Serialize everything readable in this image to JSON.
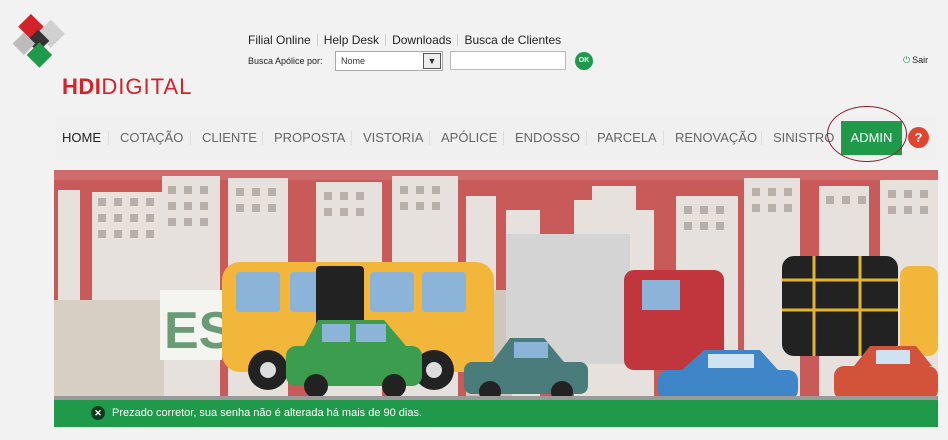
{
  "brand": {
    "logo_prefix": "HDI",
    "logo_suffix": "DIGITAL"
  },
  "top_links": [
    "Filial Online",
    "Help Desk",
    "Downloads",
    "Busca de Clientes"
  ],
  "search": {
    "label": "Busca Apólice por:",
    "selected": "Nome",
    "input_value": "",
    "ok_label": "OK"
  },
  "logout": {
    "label": "Sair"
  },
  "nav": {
    "items": [
      "HOME",
      "COTAÇÃO",
      "CLIENTE",
      "PROPOSTA",
      "VISTORIA",
      "APÓLICE",
      "ENDOSSO",
      "PARCELA",
      "RENOVAÇÃO",
      "SINISTRO"
    ],
    "admin_label": "ADMIN",
    "help_label": "?"
  },
  "banner": {
    "partial_text": "ES"
  },
  "notice": {
    "message": "Prezado corretor, sua senha não é alterada há mais de 90 dias."
  },
  "colors": {
    "brand_green": "#1e9a4a",
    "brand_red": "#d2232a",
    "help_red": "#e0452f",
    "banner_sky": "#c85a5a"
  }
}
